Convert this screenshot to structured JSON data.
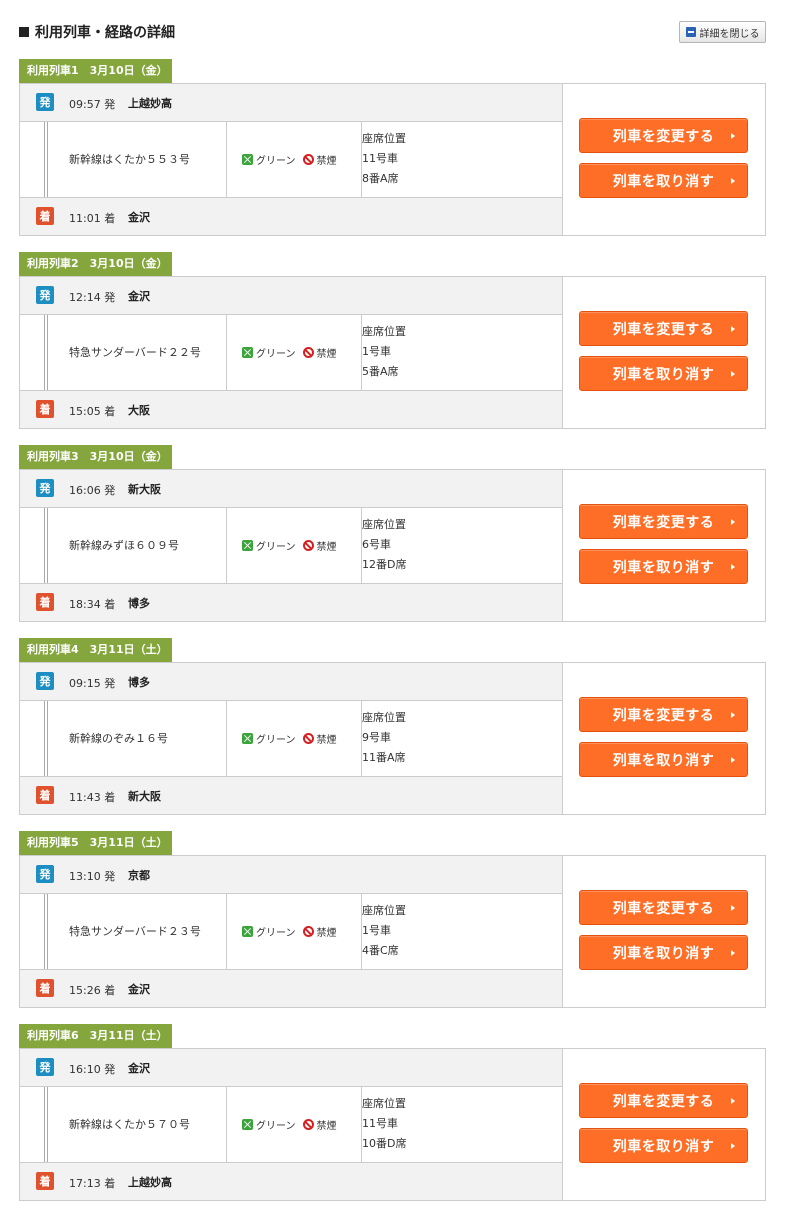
{
  "header": {
    "title": "利用列車・経路の詳細",
    "close_label": "詳細を閉じる"
  },
  "labels": {
    "dep_badge": "発",
    "arr_badge": "着",
    "green": "グリーン",
    "nosmoke": "禁煙",
    "seat_title": "座席位置",
    "change_button": "列車を変更する",
    "cancel_button": "列車を取り消す"
  },
  "trains": [
    {
      "tag": "利用列車1　3月10日（金）",
      "dep_time": "09:57 発",
      "dep_station": "上越妙高",
      "name": "新幹線はくたか５５３号",
      "car": "11号車",
      "seat": "8番A席",
      "arr_time": "11:01 着",
      "arr_station": "金沢"
    },
    {
      "tag": "利用列車2　3月10日（金）",
      "dep_time": "12:14 発",
      "dep_station": "金沢",
      "name": "特急サンダーバード２２号",
      "car": "1号車",
      "seat": "5番A席",
      "arr_time": "15:05 着",
      "arr_station": "大阪"
    },
    {
      "tag": "利用列車3　3月10日（金）",
      "dep_time": "16:06 発",
      "dep_station": "新大阪",
      "name": "新幹線みずほ６０９号",
      "car": "6号車",
      "seat": "12番D席",
      "arr_time": "18:34 着",
      "arr_station": "博多"
    },
    {
      "tag": "利用列車4　3月11日（土）",
      "dep_time": "09:15 発",
      "dep_station": "博多",
      "name": "新幹線のぞみ１６号",
      "car": "9号車",
      "seat": "11番A席",
      "arr_time": "11:43 着",
      "arr_station": "新大阪"
    },
    {
      "tag": "利用列車5　3月11日（土）",
      "dep_time": "13:10 発",
      "dep_station": "京都",
      "name": "特急サンダーバード２３号",
      "car": "1号車",
      "seat": "4番C席",
      "arr_time": "15:26 着",
      "arr_station": "金沢"
    },
    {
      "tag": "利用列車6　3月11日（土）",
      "dep_time": "16:10 発",
      "dep_station": "金沢",
      "name": "新幹線はくたか５７０号",
      "car": "11号車",
      "seat": "10番D席",
      "arr_time": "17:13 着",
      "arr_station": "上越妙高"
    }
  ]
}
